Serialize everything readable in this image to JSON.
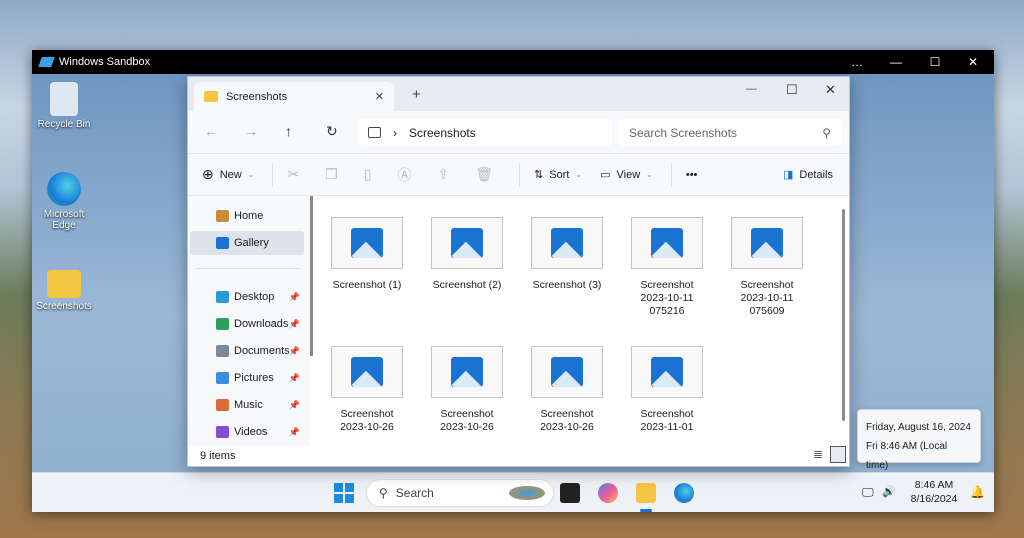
{
  "sandbox": {
    "title": "Windows Sandbox",
    "controls": [
      "…",
      "—",
      "☐",
      "✕"
    ]
  },
  "desktop": {
    "icons": [
      {
        "label": "Recycle Bin"
      },
      {
        "label": "Microsoft Edge"
      },
      {
        "label": "Screenshots"
      }
    ]
  },
  "explorer": {
    "tab": {
      "title": "Screenshots",
      "close": "✕",
      "new_tab": "+"
    },
    "window_controls": [
      "—",
      "☐",
      "✕"
    ],
    "nav": {
      "back": "←",
      "forward": "→",
      "up": "↑",
      "refresh": "↻"
    },
    "breadcrumb": {
      "separator": "›",
      "current": "Screenshots"
    },
    "search": {
      "placeholder": "Search Screenshots",
      "icon": "⚲"
    },
    "toolbar": {
      "new": "New",
      "sort": "Sort",
      "view": "View",
      "more": "•••",
      "details": "Details"
    },
    "sidebar": [
      {
        "label": "Home"
      },
      {
        "label": "Gallery"
      },
      {
        "label": "Desktop"
      },
      {
        "label": "Downloads"
      },
      {
        "label": "Documents"
      },
      {
        "label": "Pictures"
      },
      {
        "label": "Music"
      },
      {
        "label": "Videos"
      }
    ],
    "files": [
      {
        "l1": "Screenshot (1)",
        "l2": "",
        "l3": ""
      },
      {
        "l1": "Screenshot (2)",
        "l2": "",
        "l3": ""
      },
      {
        "l1": "Screenshot (3)",
        "l2": "",
        "l3": ""
      },
      {
        "l1": "Screenshot",
        "l2": "2023-10-11",
        "l3": "075216"
      },
      {
        "l1": "Screenshot",
        "l2": "2023-10-11",
        "l3": "075609"
      },
      {
        "l1": "Screenshot",
        "l2": "2023-10-26",
        "l3": ""
      },
      {
        "l1": "Screenshot",
        "l2": "2023-10-26",
        "l3": ""
      },
      {
        "l1": "Screenshot",
        "l2": "2023-10-26",
        "l3": ""
      },
      {
        "l1": "Screenshot",
        "l2": "2023-11-01",
        "l3": ""
      }
    ],
    "status": "9 items"
  },
  "taskbar": {
    "search": "Search",
    "time": "8:46 AM",
    "date": "8/16/2024"
  },
  "tooltip": {
    "line1": "Friday, August 16, 2024",
    "line2": "Fri 8:46 AM (Local time)"
  }
}
